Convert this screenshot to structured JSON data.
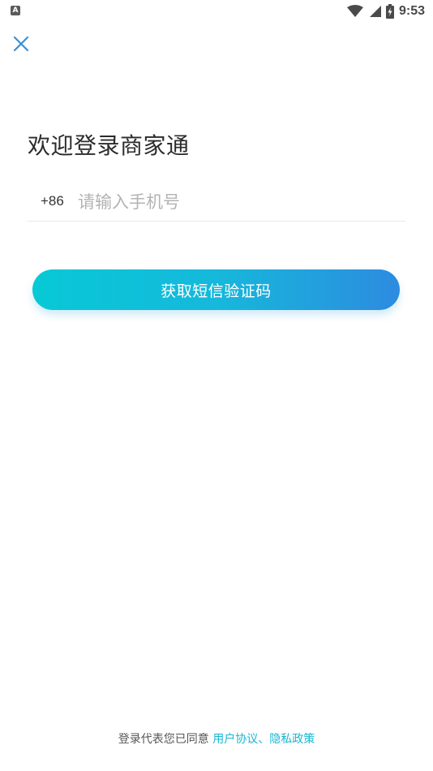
{
  "status_bar": {
    "notification_icon_letter": "A",
    "time": "9:53"
  },
  "header": {
    "close_icon": "close-icon"
  },
  "login": {
    "title": "欢迎登录商家通",
    "country_code": "+86",
    "phone_placeholder": "请输入手机号",
    "phone_value": "",
    "submit_label": "获取短信验证码"
  },
  "footer": {
    "agreement_prefix": "登录代表您已同意",
    "user_agreement_link": "用户协议",
    "separator": "、",
    "privacy_policy_link": "隐私政策"
  },
  "colors": {
    "accent_start": "#07c9d6",
    "accent_end": "#2d8be0",
    "link": "#17b7d3",
    "close_icon": "#3a8fd6"
  }
}
